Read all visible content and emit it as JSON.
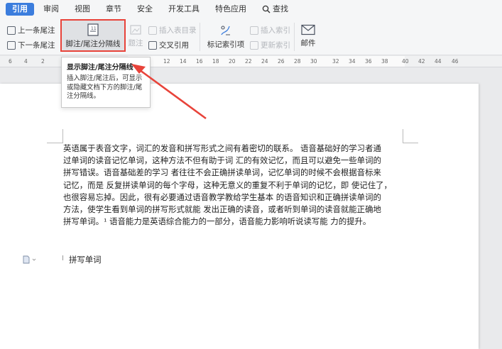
{
  "menu": {
    "tabs": [
      "引用",
      "审阅",
      "视图",
      "章节",
      "安全",
      "开发工具",
      "特色应用"
    ],
    "active_tab": "引用",
    "search_label": "查找"
  },
  "ribbon": {
    "prev_endnote": "上一条尾注",
    "next_endnote": "下一条尾注",
    "footnote_separator": "脚注/尾注分隔线",
    "insert_toc": "插入表目录",
    "caption": "题注",
    "cross_reference": "交叉引用",
    "mark_index": "标记索引项",
    "insert_index": "插入索引",
    "update_index": "更新索引",
    "mail": "邮件"
  },
  "ruler": {
    "labels": [
      "6",
      "4",
      "2",
      "12",
      "14",
      "16",
      "18",
      "20",
      "22",
      "24",
      "26",
      "28",
      "30",
      "32",
      "34",
      "36",
      "38",
      "40",
      "42",
      "44",
      "46"
    ]
  },
  "tooltip": {
    "title": "显示脚注/尾注分隔线",
    "description": "插入脚注/尾注后，可显示或隐藏文档下方的脚注/尾注分隔线。"
  },
  "document": {
    "lines": [
      "英语属于表音文字，词汇的发音和拼写形式之间有着密切的联系。 语音基础好的学习者通",
      "过单词的读音记忆单词，这种方法不但有助于词  汇的有效记忆，而且可以避免一些单词的",
      "拼写错误。语音基础差的学习  者往往不会正确拼读单词，记忆单词的时候不会根据音标来",
      "记忆，而是  反复拼读单词的每个字母，这种无意义的重复不利于单词的记忆，即  使记住了，",
      "也很容易忘掉。因此，很有必要通过语音教学教给学生基本  的语音知识和正确拼读单词的",
      "方法，使学生看到单词的拼写形式就能  发出正确的读音，或者听到单词的读音就能正确地",
      "拼写单词。¹ 语音能力是英语综合能力的一部分，语音能力影响听说读写能  力的提升。"
    ],
    "second_paragraph": "拼写单词"
  },
  "colors": {
    "accent": "#3b7ddd",
    "highlight": "#e8433a"
  }
}
